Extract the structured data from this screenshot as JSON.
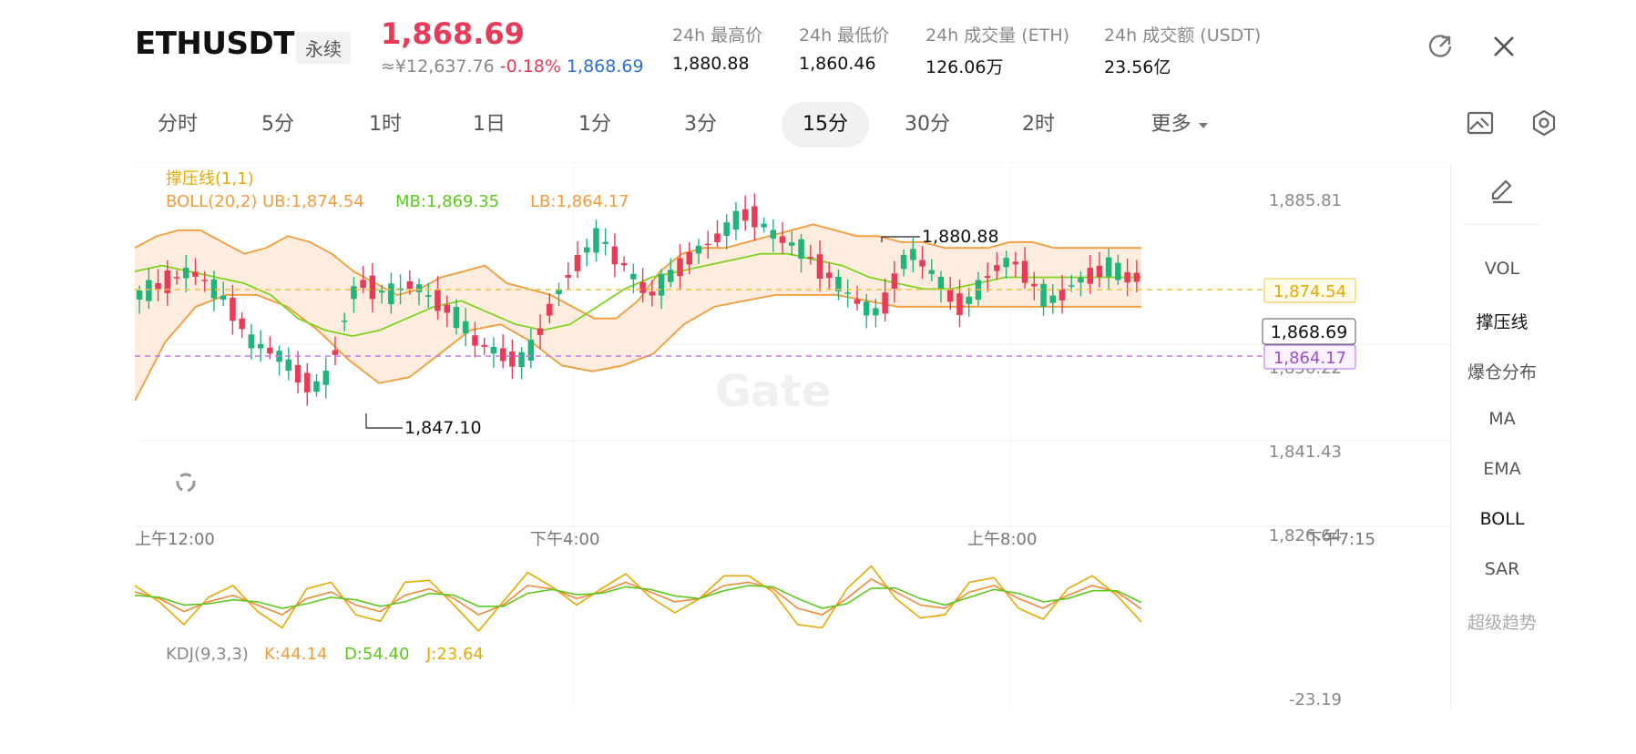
{
  "header": {
    "symbol": "ETHUSDT",
    "contract_type": "永续",
    "last_price": "1,868.69",
    "cny_price": "≈¥12,637.76",
    "change_pct": "-0.18%",
    "mark_price": "1,868.69",
    "stats": [
      {
        "label": "24h 最高价",
        "value": "1,880.88"
      },
      {
        "label": "24h 最低价",
        "value": "1,860.46"
      },
      {
        "label": "24h 成交量 (ETH)",
        "value": "126.06万"
      },
      {
        "label": "24h 成交额 (USDT)",
        "value": "23.56亿"
      }
    ],
    "icons": {
      "refresh": "external-refresh-icon",
      "close": "close-icon"
    }
  },
  "intervals": {
    "items": [
      "分时",
      "5分",
      "1时",
      "1日",
      "1分",
      "3分",
      "15分",
      "30分",
      "2时",
      "更多"
    ],
    "active": "15分",
    "more_icon": "caret-down-icon"
  },
  "toolbar_icons": {
    "screenshot": "chart-image-icon",
    "settings": "hexagon-settings-icon"
  },
  "indicators": {
    "support_line_label": "撑压线(1,1)",
    "boll_label": "BOLL(20,2)",
    "ub": "UB:1,874.54",
    "mb": "MB:1,869.35",
    "lb": "LB:1,864.17",
    "kdj_label": "KDJ(9,3,3)",
    "k": "K:44.14",
    "d": "D:54.40",
    "j": "J:23.64"
  },
  "side_panel": {
    "draw_icon": "pencil-draw-icon",
    "items": [
      "VOL",
      "撑压线",
      "爆仓分布",
      "MA",
      "EMA",
      "BOLL",
      "SAR",
      "超级趋势"
    ],
    "active": [
      "撑压线",
      "BOLL"
    ]
  },
  "watermark": "Gate",
  "colors": {
    "up": "#21b37c",
    "down": "#e83b57",
    "boll": "#f29b38",
    "mb": "#7ed321",
    "resist": "#f0c040",
    "support": "#b46fe0"
  },
  "chart_data": {
    "type": "candlestick",
    "interval": "15分",
    "y_ticks": [
      "1,885.81",
      "1,856.22",
      "1,841.43",
      "1,826.64"
    ],
    "kdj_tick": "-23.19",
    "x_ticks": [
      "上午12:00",
      "下午4:00",
      "上午8:00",
      "下午7:15"
    ],
    "annotations": {
      "high": "1,880.88",
      "low": "1,847.10"
    },
    "price_tags": {
      "resistance": "1,874.54",
      "last": "1,868.69",
      "support": "1,864.17"
    },
    "ylim": [
      1826.64,
      1885.81
    ],
    "price_series": [
      1866,
      1867,
      1868,
      1869,
      1870,
      1869,
      1867,
      1865,
      1862,
      1858,
      1857,
      1856,
      1854,
      1852,
      1850,
      1852,
      1858,
      1866,
      1868,
      1867,
      1866,
      1867,
      1868,
      1866,
      1865,
      1863,
      1861,
      1858,
      1857,
      1856,
      1855,
      1855,
      1859,
      1864,
      1868,
      1871,
      1874,
      1876,
      1873,
      1871,
      1868,
      1866,
      1868,
      1870,
      1872,
      1874,
      1875,
      1877,
      1879,
      1880,
      1878,
      1876,
      1875,
      1874,
      1872,
      1870,
      1868,
      1866,
      1864,
      1863,
      1865,
      1871,
      1873,
      1871,
      1869,
      1866,
      1864,
      1866,
      1869,
      1871,
      1872,
      1870,
      1867,
      1865,
      1866,
      1868,
      1869,
      1870,
      1871,
      1869,
      1869
    ],
    "boll_upper": [
      1874,
      1876,
      1877,
      1877,
      1875,
      1873,
      1874,
      1876,
      1875,
      1873,
      1870,
      1868,
      1866,
      1867,
      1869,
      1870,
      1871,
      1868,
      1867,
      1866,
      1864,
      1862,
      1862,
      1865,
      1870,
      1873,
      1874,
      1874,
      1875,
      1876,
      1877,
      1878,
      1877,
      1876,
      1876,
      1875,
      1875,
      1874,
      1874,
      1874,
      1875,
      1875,
      1874,
      1874,
      1874,
      1874,
      1874
    ],
    "boll_mid": [
      1870,
      1871,
      1870,
      1869,
      1868,
      1866,
      1862,
      1860,
      1859,
      1860,
      1862,
      1864,
      1865,
      1863,
      1861,
      1860,
      1861,
      1864,
      1867,
      1869,
      1870,
      1871,
      1872,
      1873,
      1873,
      1872,
      1871,
      1869,
      1868,
      1867,
      1867,
      1868,
      1869,
      1869,
      1869,
      1869,
      1869,
      1869
    ],
    "boll_lower": [
      1848,
      1858,
      1864,
      1866,
      1866,
      1864,
      1860,
      1855,
      1851,
      1852,
      1856,
      1860,
      1861,
      1858,
      1854,
      1853,
      1854,
      1856,
      1861,
      1864,
      1865,
      1866,
      1866,
      1866,
      1865,
      1864,
      1864,
      1864,
      1864,
      1864,
      1864,
      1864,
      1864,
      1864
    ],
    "kdj": {
      "k_last": 44.14,
      "d_last": 54.4,
      "j_last": 23.64,
      "min_tick": -23.19,
      "k": [
        70,
        60,
        40,
        55,
        65,
        50,
        35,
        60,
        70,
        50,
        40,
        65,
        75,
        60,
        35,
        50,
        80,
        75,
        60,
        70,
        85,
        70,
        55,
        60,
        80,
        85,
        75,
        45,
        35,
        60,
        90,
        70,
        50,
        45,
        70,
        80,
        60,
        45,
        65,
        80,
        70,
        44
      ],
      "d": [
        65,
        62,
        50,
        52,
        58,
        55,
        45,
        52,
        62,
        58,
        48,
        55,
        68,
        65,
        48,
        48,
        68,
        74,
        66,
        68,
        78,
        74,
        64,
        60,
        72,
        80,
        78,
        60,
        45,
        52,
        76,
        76,
        60,
        50,
        62,
        74,
        68,
        55,
        60,
        72,
        72,
        54
      ],
      "j": [
        80,
        55,
        20,
        62,
        80,
        40,
        15,
        75,
        85,
        35,
        25,
        85,
        88,
        50,
        10,
        55,
        100,
        78,
        50,
        75,
        98,
        62,
        38,
        60,
        95,
        95,
        70,
        20,
        15,
        75,
        110,
        60,
        30,
        35,
        85,
        92,
        45,
        28,
        75,
        95,
        65,
        24
      ]
    }
  }
}
